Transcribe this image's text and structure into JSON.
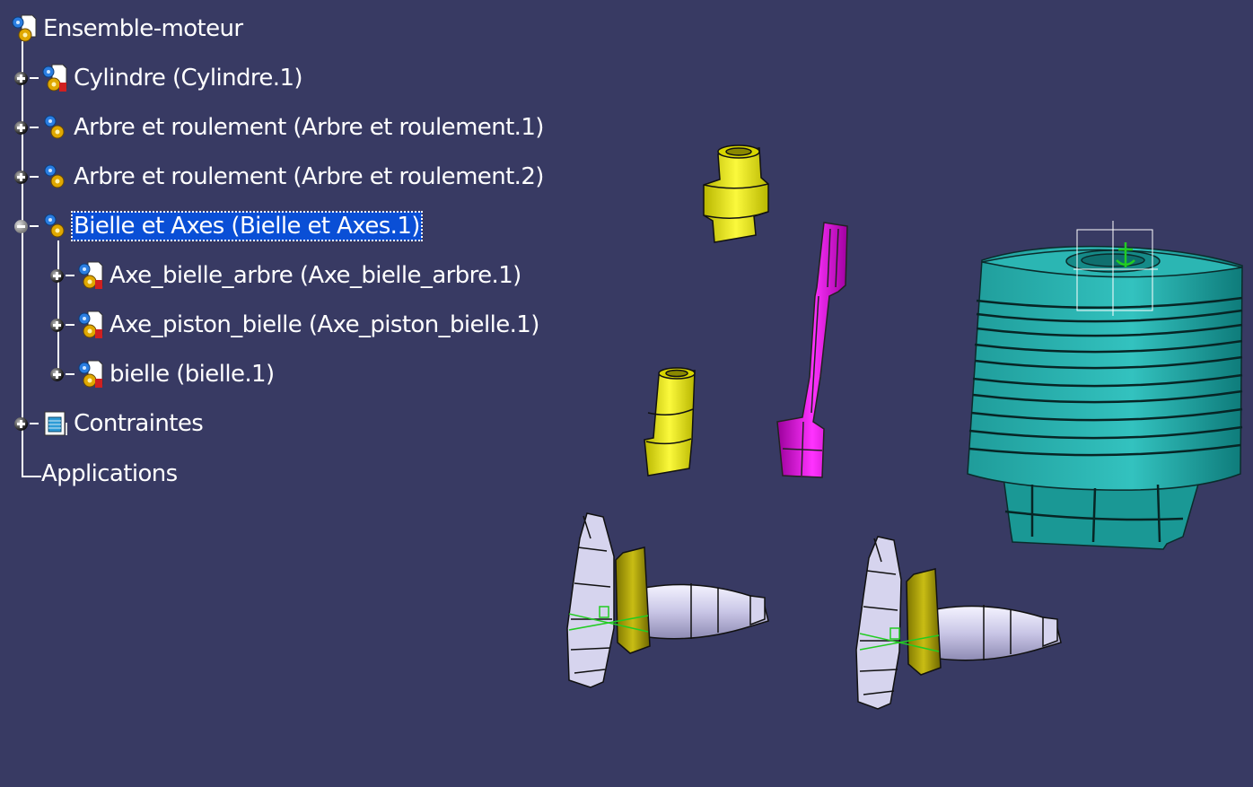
{
  "colors": {
    "background": "#383a63",
    "selection": "#0a4fd6",
    "cylinder": "#2ab0ad",
    "axes": "#e8e600",
    "connecting_rod": "#d400d4",
    "shaft": "#d6d4ee",
    "bearing": "#b0a400",
    "constraint_marker": "#22cc22"
  },
  "tree": {
    "root": {
      "label": "Ensemble-moteur",
      "icon": "product-icon"
    },
    "items": [
      {
        "label": "Cylindre (Cylindre.1)",
        "icon": "part-icon",
        "state": "collapsed",
        "selected": false
      },
      {
        "label": "Arbre et roulement (Arbre et roulement.1)",
        "icon": "product-icon",
        "state": "collapsed",
        "selected": false
      },
      {
        "label": "Arbre et roulement (Arbre et roulement.2)",
        "icon": "product-icon",
        "state": "collapsed",
        "selected": false
      },
      {
        "label": "Bielle et Axes (Bielle et Axes.1)",
        "icon": "product-icon",
        "state": "expanded",
        "selected": true
      },
      {
        "label": "Axe_bielle_arbre (Axe_bielle_arbre.1)",
        "icon": "part-icon",
        "state": "collapsed",
        "selected": false
      },
      {
        "label": "Axe_piston_bielle (Axe_piston_bielle.1)",
        "icon": "part-icon",
        "state": "collapsed",
        "selected": false
      },
      {
        "label": "bielle (bielle.1)",
        "icon": "part-icon",
        "state": "collapsed",
        "selected": false
      },
      {
        "label": "Contraintes",
        "icon": "constraints-icon",
        "state": "collapsed",
        "selected": false
      },
      {
        "label": "Applications",
        "icon": "",
        "state": "leaf",
        "selected": false
      }
    ]
  }
}
